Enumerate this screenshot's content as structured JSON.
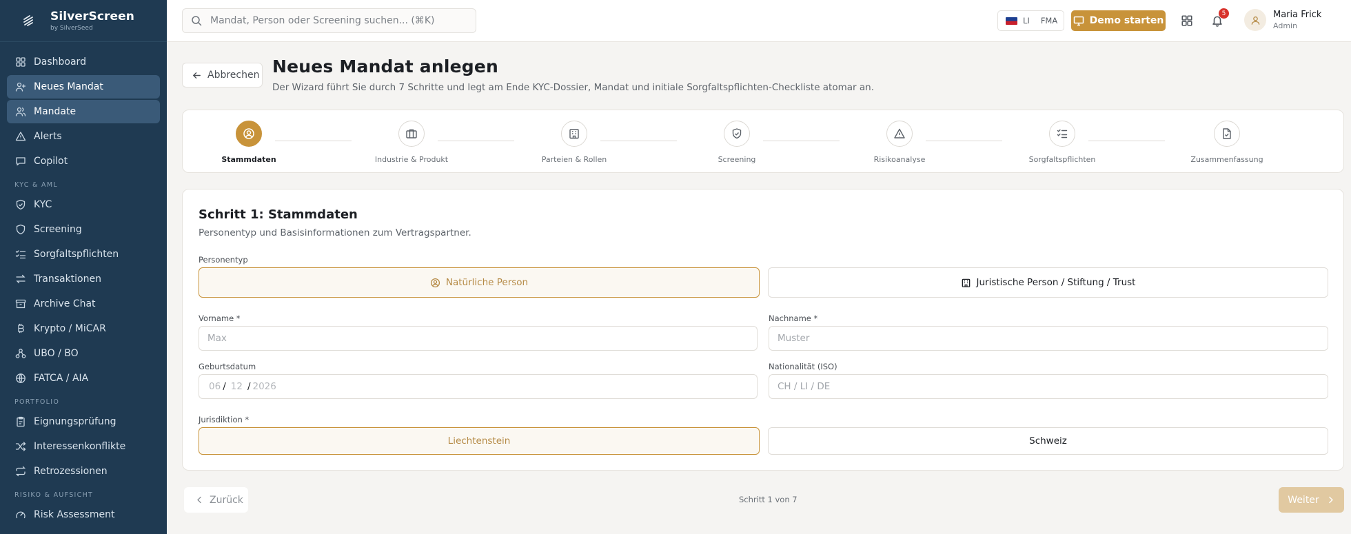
{
  "brand": {
    "name": "SilverScreen",
    "sub": "by SilverSeed"
  },
  "sidebar": {
    "items": [
      {
        "label": "Dashboard",
        "icon": "dashboard-icon",
        "active": false
      },
      {
        "label": "Neues Mandat",
        "icon": "user-plus-icon",
        "active": true
      },
      {
        "label": "Mandate",
        "icon": "users-icon",
        "active": true
      },
      {
        "label": "Alerts",
        "icon": "alert-triangle-icon",
        "active": false
      },
      {
        "label": "Copilot",
        "icon": "chat-icon",
        "active": false
      }
    ],
    "section_kyc": "KYC & AML",
    "kyc_items": [
      {
        "label": "KYC",
        "icon": "shield-check-icon"
      },
      {
        "label": "Screening",
        "icon": "shield-icon"
      },
      {
        "label": "Sorgfaltspflichten",
        "icon": "list-checks-icon"
      },
      {
        "label": "Transaktionen",
        "icon": "arrows-icon"
      },
      {
        "label": "Archive Chat",
        "icon": "archive-icon"
      },
      {
        "label": "Krypto / MiCAR",
        "icon": "bitcoin-icon"
      },
      {
        "label": "UBO / BO",
        "icon": "network-icon"
      },
      {
        "label": "FATCA / AIA",
        "icon": "globe-icon"
      }
    ],
    "section_portfolio": "Portfolio",
    "portfolio_items": [
      {
        "label": "Eignungsprüfung",
        "icon": "clipboard-icon"
      },
      {
        "label": "Interessenkonflikte",
        "icon": "shuffle-icon"
      },
      {
        "label": "Retrozessionen",
        "icon": "repeat-icon"
      }
    ],
    "section_risk": "Risiko & Aufsicht",
    "risk_items": [
      {
        "label": "Risk Assessment",
        "icon": "gauge-icon"
      }
    ]
  },
  "topbar": {
    "search_placeholder": "Mandat, Person oder Screening suchen... (⌘K)",
    "lang_li": "LI",
    "lang_fma": "FMA",
    "demo_label": "Demo starten",
    "notification_count": "5",
    "user_name": "Maria Frick",
    "user_role": "Admin"
  },
  "header": {
    "cancel_label": "Abbrechen",
    "title": "Neues Mandat anlegen",
    "subtitle": "Der Wizard führt Sie durch 7 Schritte und legt am Ende KYC-Dossier, Mandat und initiale Sorgfaltspflichten-Checkliste atomar an."
  },
  "steps": [
    {
      "label": "Stammdaten",
      "icon": "user-circle-icon",
      "active": true
    },
    {
      "label": "Industrie & Produkt",
      "icon": "briefcase-icon",
      "active": false
    },
    {
      "label": "Parteien & Rollen",
      "icon": "building-icon",
      "active": false
    },
    {
      "label": "Screening",
      "icon": "shield-check-icon",
      "active": false
    },
    {
      "label": "Risikoanalyse",
      "icon": "alert-triangle-icon",
      "active": false
    },
    {
      "label": "Sorgfaltspflichten",
      "icon": "list-checks-icon",
      "active": false
    },
    {
      "label": "Zusammenfassung",
      "icon": "file-check-icon",
      "active": false
    }
  ],
  "form": {
    "title": "Schritt 1: Stammdaten",
    "subtitle": "Personentyp und Basisinformationen zum Vertragspartner.",
    "person_type_label": "Personentyp",
    "person_natural": "Natürliche Person",
    "person_legal": "Juristische Person / Stiftung / Trust",
    "first_name_label": "Vorname *",
    "first_name_placeholder": "Max",
    "last_name_label": "Nachname *",
    "last_name_placeholder": "Muster",
    "birthdate_label": "Geburtsdatum",
    "birthdate_day": "06",
    "birthdate_month": "12",
    "birthdate_year": "2026",
    "birthdate_sep": "/",
    "nationality_label": "Nationalität (ISO)",
    "nationality_placeholder": "CH / LI / DE",
    "jurisdiction_label": "Jurisdiktion *",
    "jurisdiction_li": "Liechtenstein",
    "jurisdiction_ch": "Schweiz"
  },
  "footer": {
    "back_label": "Zurück",
    "step_counter": "Schritt 1 von 7",
    "next_label": "Weiter"
  },
  "colors": {
    "accent": "#c8933a",
    "sidebar": "#1f3a52",
    "sidebar_active": "#3a5a78"
  }
}
